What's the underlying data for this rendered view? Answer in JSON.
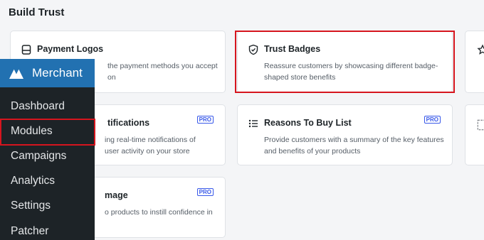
{
  "section_title": "Build Trust",
  "cards": {
    "payment_logos": {
      "title": "Payment Logos",
      "desc": "the payment methods you accept on",
      "icon": "credit-card-icon"
    },
    "trust_badges": {
      "title": "Trust Badges",
      "desc": "Reassure customers by showcasing different badge-shaped store benefits",
      "icon": "shield-check-icon"
    },
    "notifications": {
      "title": "tifications",
      "desc": "ing real-time notifications of user activity on your store",
      "badge": "PRO"
    },
    "reasons_to_buy": {
      "title": "Reasons To Buy List",
      "desc": "Provide customers with a summary of the key features and benefits of your products",
      "badge": "PRO",
      "icon": "list-icon"
    },
    "image": {
      "title": "mage",
      "desc": "o products to instill confidence in",
      "badge": "PRO"
    }
  },
  "sidebar": {
    "brand": "Merchant",
    "items": [
      {
        "label": "Dashboard"
      },
      {
        "label": "Modules"
      },
      {
        "label": "Campaigns"
      },
      {
        "label": "Analytics"
      },
      {
        "label": "Settings"
      },
      {
        "label": "Patcher"
      }
    ]
  },
  "colors": {
    "accent": "#2271b1",
    "highlight": "#d6151e",
    "pro": "#3858e9",
    "sidebar": "#1d2327"
  }
}
